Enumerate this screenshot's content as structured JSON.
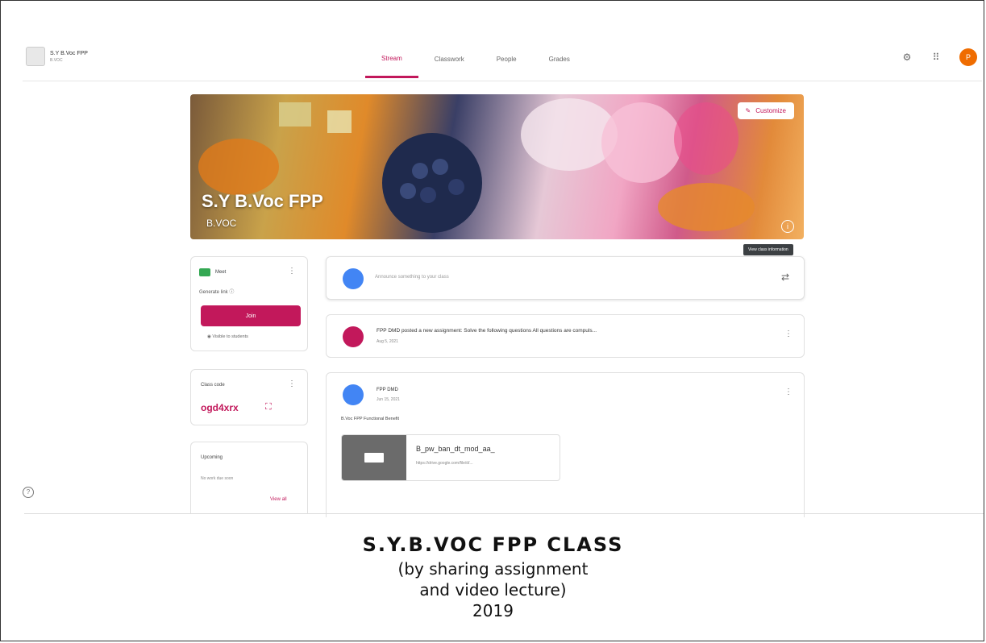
{
  "app": {
    "class_name": "S.Y B.Voc FPP",
    "class_section": "B.VOC"
  },
  "nav": {
    "tabs": [
      {
        "label": "Stream",
        "active": true
      },
      {
        "label": "Classwork",
        "active": false
      },
      {
        "label": "People",
        "active": false
      },
      {
        "label": "Grades",
        "active": false
      }
    ],
    "avatar_letter": "P"
  },
  "banner": {
    "title": "S.Y B.Voc FPP",
    "section": "B.VOC",
    "customize_label": "Customize",
    "tooltip": "View class information"
  },
  "meet": {
    "label": "Meet",
    "link_label": "Generate link",
    "join_label": "Join",
    "visibility_note": "Visible to students"
  },
  "class_code": {
    "label": "Class code",
    "value": "ogd4xrx"
  },
  "upcoming": {
    "title": "Upcoming",
    "note": "No work due soon",
    "view_all": "View all"
  },
  "stream": {
    "announce_placeholder": "Announce something to your class",
    "assignment": {
      "text": "FPP DMD posted a new assignment: Solve the following questions All questions are compuls...",
      "date": "Aug 5, 2021"
    },
    "post": {
      "author": "FPP DMD",
      "date": "Jun 15, 2021",
      "body": "B.Voc FPP Functional Benefit",
      "attachment_title": "B_pw_ban_dt_mod_aa_",
      "attachment_url": "https://drive.google.com/file/d/..."
    }
  },
  "caption": {
    "line1": "S.Y.B.VOC FPP CLASS",
    "line2": "(by sharing assignment",
    "line3": "and video lecture)",
    "line4": "2019"
  },
  "colors": {
    "accent": "#c2185b",
    "avatar": "#ef6c00",
    "meet_green": "#34a853",
    "blue": "#4285f4"
  }
}
